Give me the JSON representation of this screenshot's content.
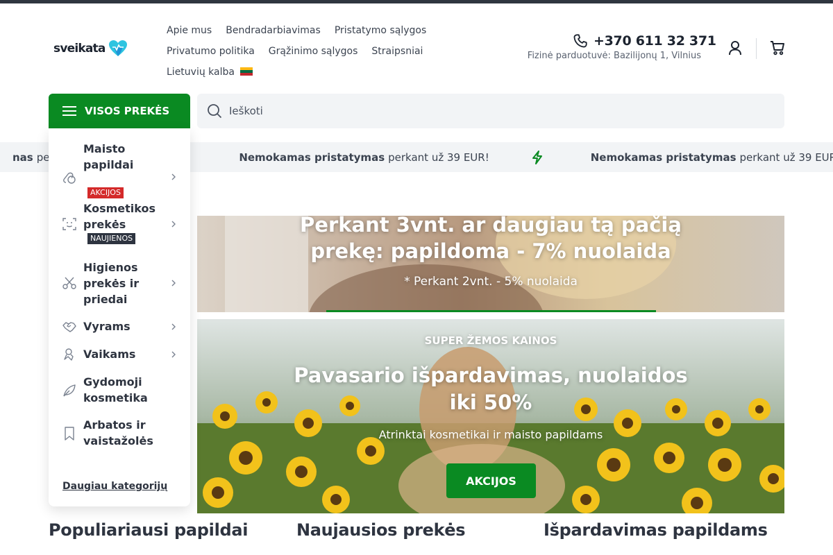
{
  "brand": {
    "name": "sveikata",
    "accent": "#0a8a22",
    "heart_colors": [
      "#2ec4e0",
      "#1a8ad6"
    ]
  },
  "nav": {
    "row1": [
      "Apie mus",
      "Bendradarbiavimas",
      "Pristatymo sąlygos"
    ],
    "row2": [
      "Privatumo politika",
      "Grąžinimo sąlygos",
      "Straipsniai"
    ],
    "language": "Lietuvių kalba"
  },
  "contact": {
    "phone": "+370 611 32 371",
    "store": "Fizinė parduotuvė: Bazilijonų 1, Vilnius"
  },
  "header_icons": [
    "phone-icon",
    "user-icon",
    "cart-icon"
  ],
  "categories_button": "VISOS PREKĖS",
  "search": {
    "placeholder": "Ieškoti"
  },
  "ticker": {
    "bold": "Nemokamas pristatymas",
    "text": "perkant už 39 EUR!",
    "partial_bold": "nas"
  },
  "side_menu": {
    "items": [
      {
        "label": "Maisto papildai",
        "badge": "AKCIJOS",
        "icon": "supplements-icon"
      },
      {
        "label": "Kosmetikos prekės",
        "badge": "NAUJIENOS",
        "icon": "face-icon"
      },
      {
        "label": "Higienos prekės ir priedai",
        "icon": "scissors-icon"
      },
      {
        "label": "Vyrams",
        "icon": "handshake-icon"
      },
      {
        "label": "Vaikams",
        "icon": "pacifier-icon"
      },
      {
        "label": "Gydomoji kosmetika",
        "icon": "leaf-icon"
      },
      {
        "label": "Arbatos ir vaistažolės",
        "icon": "bookmark-icon"
      }
    ],
    "more": "Daugiau kategorijų"
  },
  "banner1": {
    "title_line1": "Perkant 3vnt. ar daugiau tą pačią",
    "title_line2": "prekę: papildoma - 7% nuolaida",
    "subtitle": "* Perkant 2vnt. - 5% nuolaida"
  },
  "banner2": {
    "eyebrow": "SUPER ŽEMOS KAINOS",
    "title_line1": "Pavasario išpardavimas, nuolaidos",
    "title_line2": "iki 50%",
    "subtitle": "Atrinktai kosmetikai ir maisto papildams",
    "cta": "AKCIJOS"
  },
  "sections": [
    "Populiariausi papildai",
    "Naujausios prekės",
    "Išpardavimas papildams"
  ]
}
